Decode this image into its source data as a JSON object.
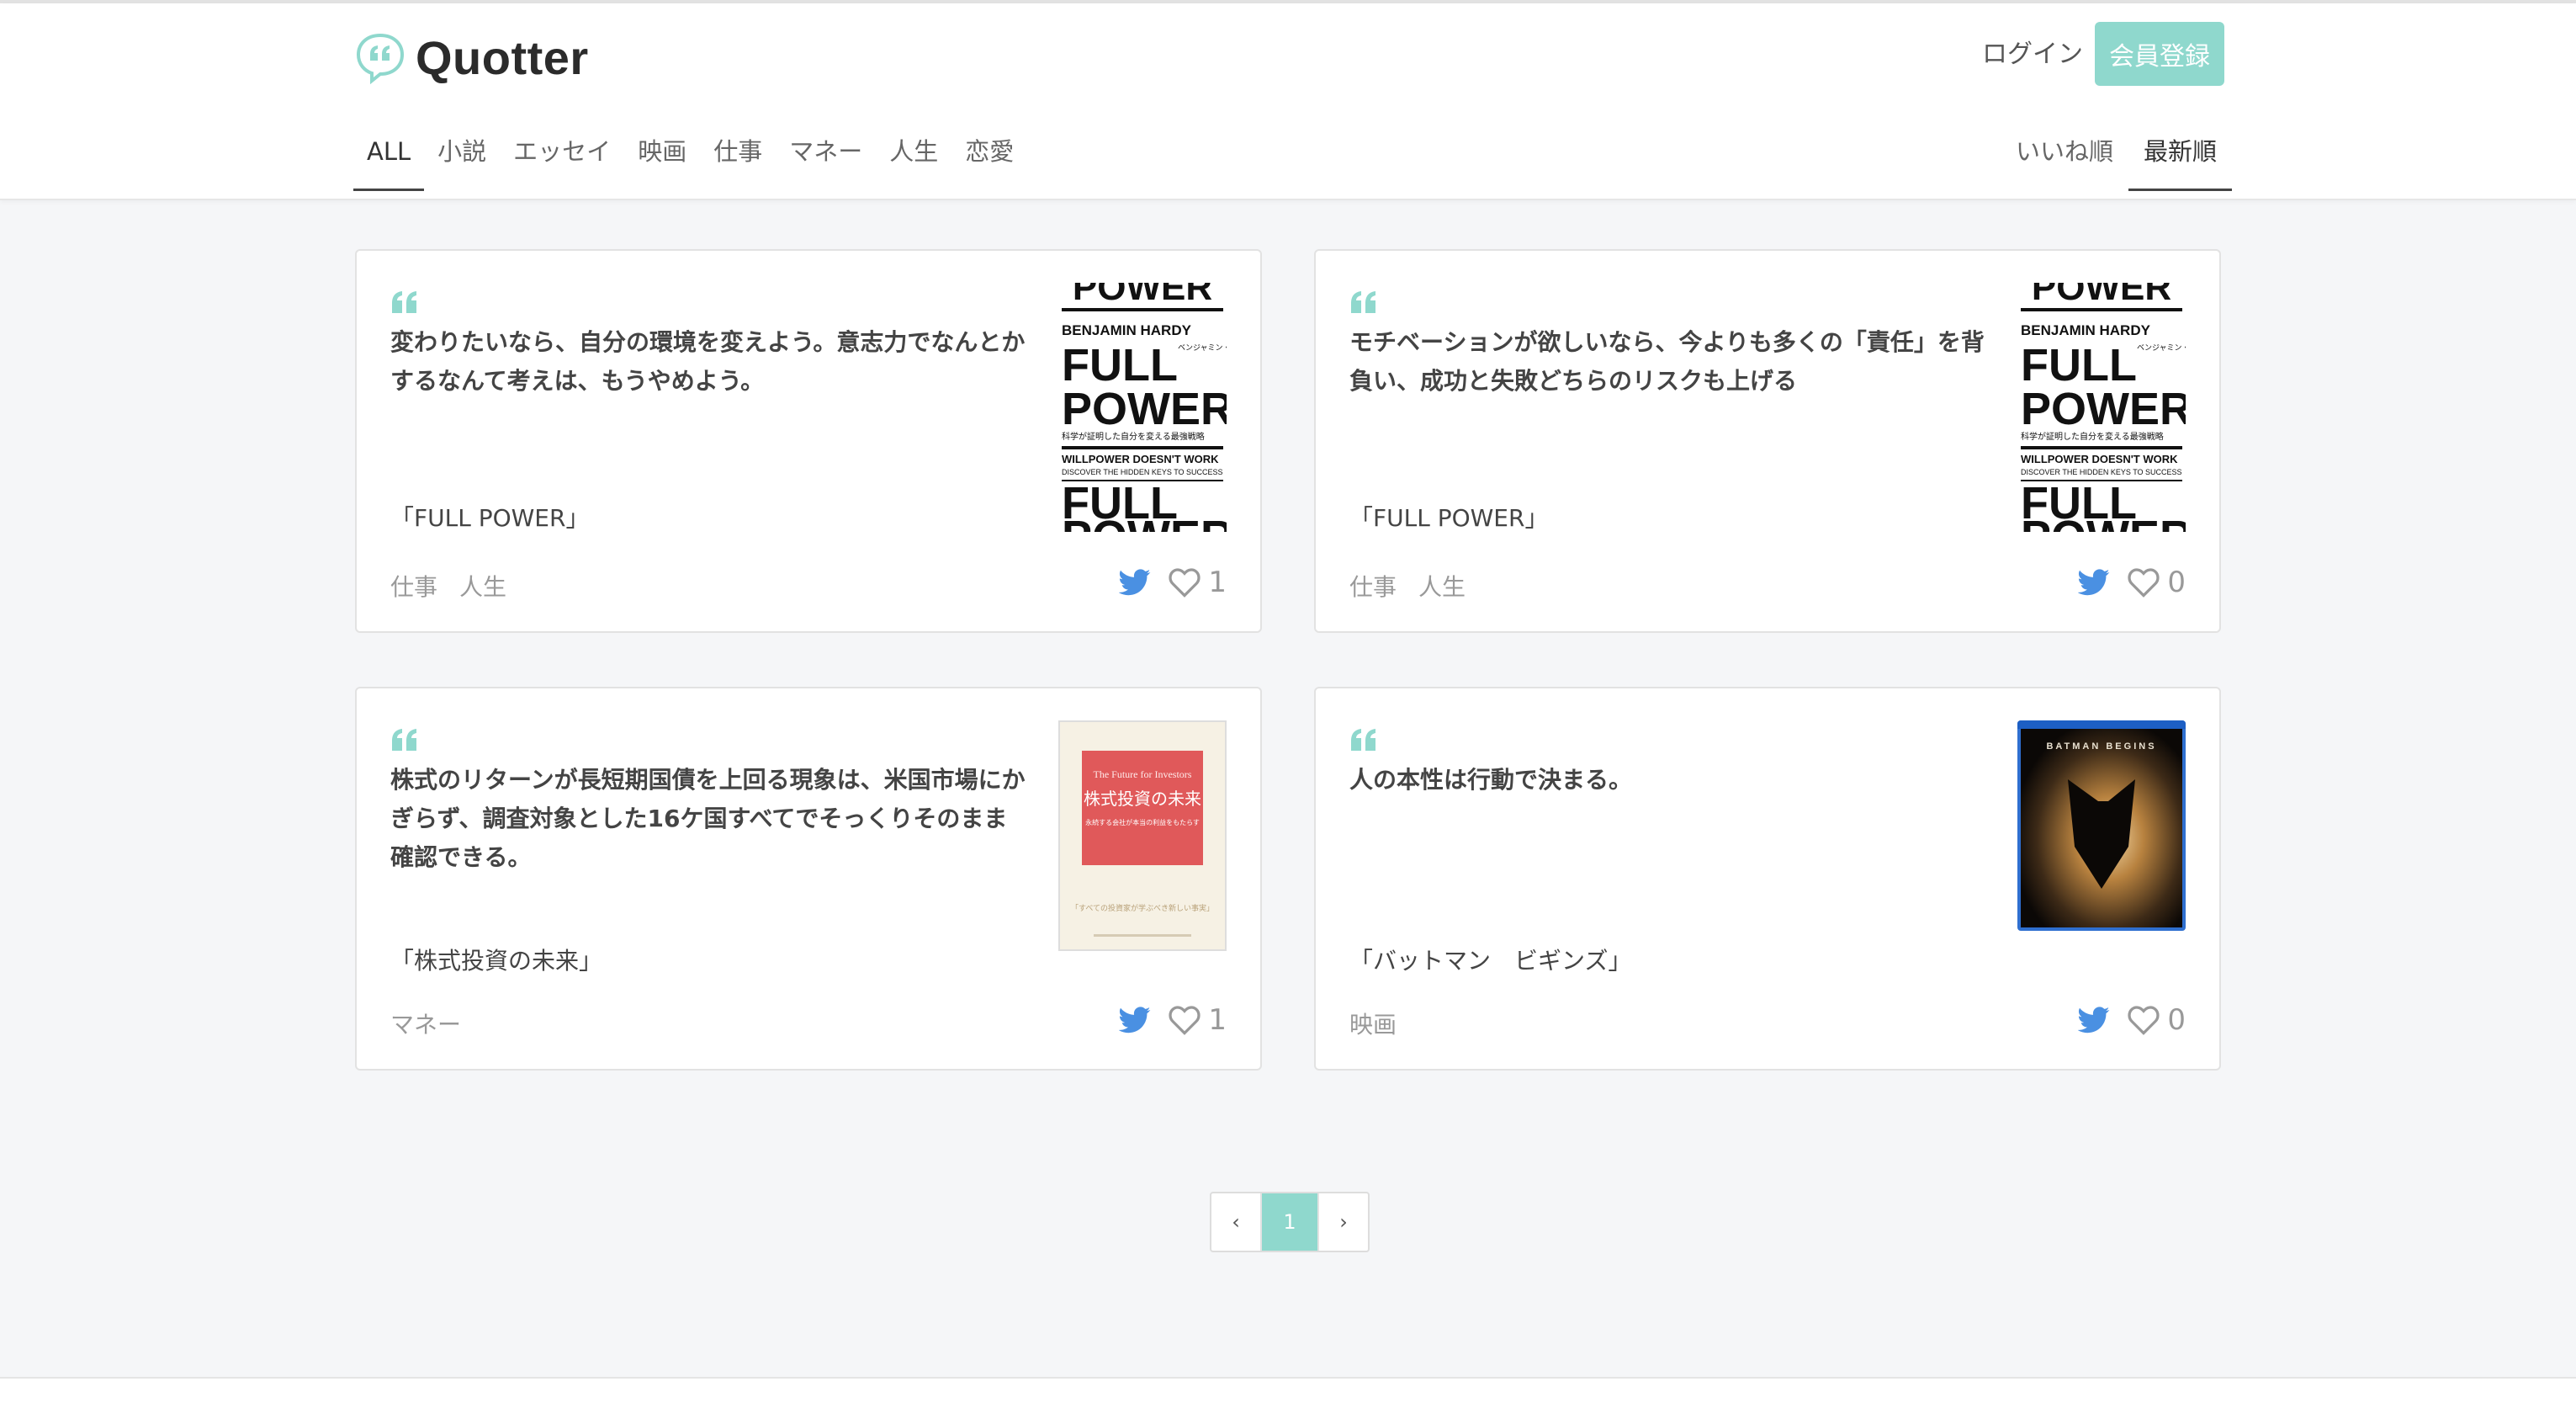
{
  "header": {
    "brand_name": "Quotter",
    "login_label": "ログイン",
    "signup_label": "会員登録",
    "categories": [
      "ALL",
      "小説",
      "エッセイ",
      "映画",
      "仕事",
      "マネー",
      "人生",
      "恋愛"
    ],
    "active_category": "ALL",
    "sort_options": [
      "いいね順",
      "最新順"
    ],
    "active_sort": "最新順"
  },
  "colors": {
    "accent": "#8fd8cd",
    "twitter": "#4a90e2"
  },
  "quotes": [
    {
      "text": "変わりたいなら、自分の環境を変えよう。意志力でなんとかするなんて考えは、もうやめよう。",
      "book": "「FULL POWER」",
      "tags": [
        "仕事",
        "人生"
      ],
      "likes": "1",
      "cover": {
        "lines": [
          "POWER",
          "BENJAMIN HARDY",
          "FULL",
          "POWER",
          "科学が証明した自分を変える最強戦略",
          "WILLPOWER DOESN'T WORK",
          "DISCOVER THE HIDDEN KEYS TO SUCCESS",
          "FULL",
          "POWER"
        ],
        "jp_author": "ベンジャミン・ハーディ"
      }
    },
    {
      "text": "モチベーションが欲しいなら、今よりも多くの「責任」を背負い、成功と失敗どちらのリスクも上げる",
      "book": "「FULL POWER」",
      "tags": [
        "仕事",
        "人生"
      ],
      "likes": "0",
      "cover": {
        "lines": [
          "POWER",
          "BENJAMIN HARDY",
          "FULL",
          "POWER",
          "科学が証明した自分を変える最強戦略",
          "WILLPOWER DOESN'T WORK",
          "DISCOVER THE HIDDEN KEYS TO SUCCESS",
          "FULL",
          "POWER"
        ],
        "jp_author": "ベンジャミン・ハーディ"
      }
    },
    {
      "text": "株式のリターンが長短期国債を上回る現象は、米国市場にかぎらず、調査対象とした16ケ国すべてでそっくりそのまま確認できる。",
      "book": "「株式投資の未来」",
      "tags": [
        "マネー"
      ],
      "likes": "1",
      "cover": {
        "en_title": "The Future for Investors",
        "jp_title": "株式投資の未来",
        "subtitle": "永続する会社が本当の利益をもたらす",
        "tagline": "「すべての投資家が学ぶべき新しい事実」"
      }
    },
    {
      "text": "人の本性は行動で決まる。",
      "book": "「バットマン　ビギンズ」",
      "tags": [
        "映画"
      ],
      "likes": "0",
      "cover": {
        "label": "BATMAN BEGINS"
      }
    }
  ],
  "pagination": {
    "prev": "‹",
    "current": "1",
    "next": "›"
  }
}
